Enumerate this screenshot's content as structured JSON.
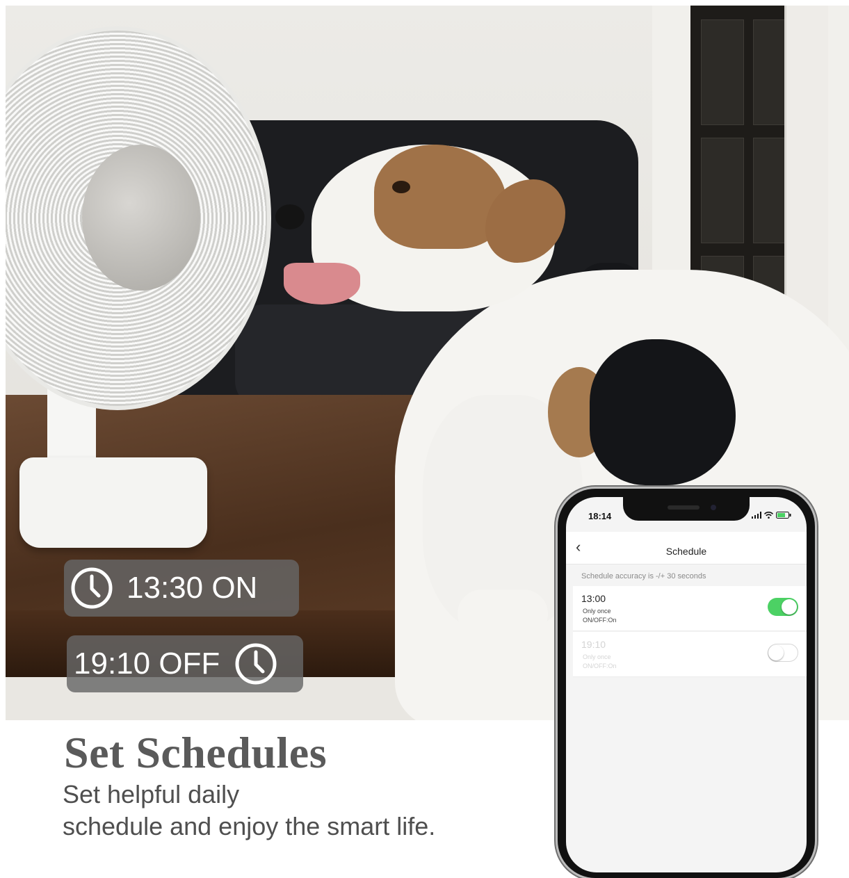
{
  "badges": {
    "on": {
      "text": "13:30 ON",
      "icon": "clock-icon"
    },
    "off": {
      "text": "19:10 OFF",
      "icon": "clock-icon"
    }
  },
  "caption": {
    "title": "Set Schedules",
    "line1": "Set helpful daily",
    "line2": "schedule and enjoy the smart life."
  },
  "phone": {
    "status_time": "18:14",
    "status_icons": [
      "signal-icon",
      "wifi-icon",
      "battery-icon"
    ],
    "nav": {
      "back_icon": "chevron-left-icon",
      "title": "Schedule"
    },
    "accuracy_note": "Schedule accuracy is -/+ 30 seconds",
    "schedules": [
      {
        "time": "13:00",
        "repeat": "Only once",
        "action": "ON/OFF:On",
        "enabled": true
      },
      {
        "time": "19:10",
        "repeat": "Only once",
        "action": "ON/OFF:On",
        "enabled": false
      }
    ]
  },
  "colors": {
    "toggle_on": "#4cd164",
    "badge_bg": "#666666",
    "caption_text": "#5a5a5a"
  }
}
